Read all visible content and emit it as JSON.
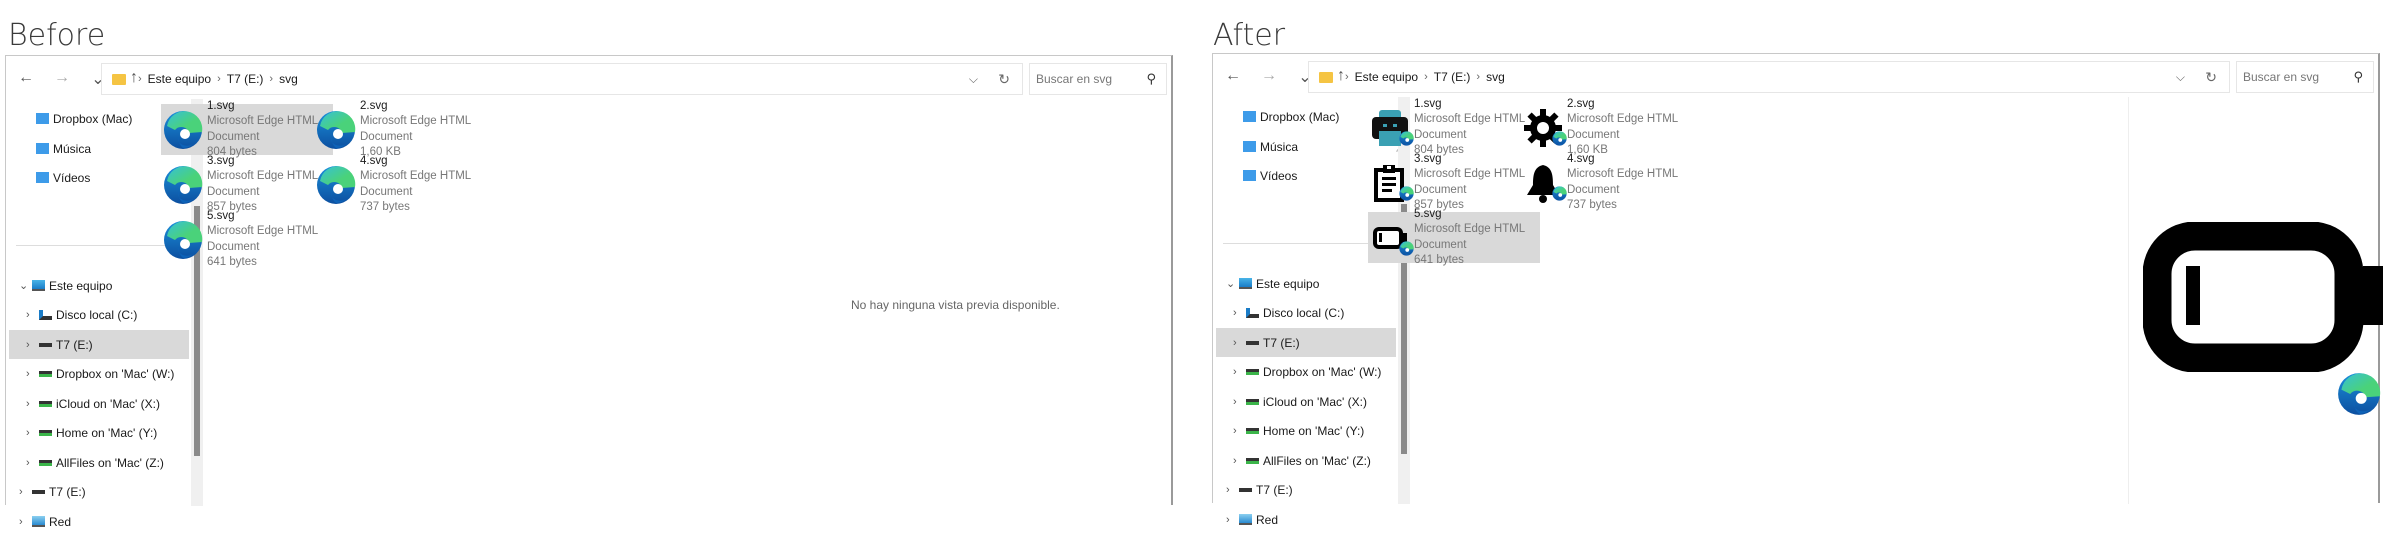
{
  "panels": [
    {
      "label": "Before",
      "selected_file": 0,
      "selected_nav": "T7 (E:)",
      "preview_text": "No hay ninguna vista previa disponible.",
      "icon_style": "edge"
    },
    {
      "label": "After",
      "selected_file": 4,
      "selected_nav": "T7 (E:)",
      "preview_icon": "battery-low-icon",
      "icon_style": "custom"
    }
  ],
  "nav_buttons": [
    "back",
    "forward",
    "recent",
    "up"
  ],
  "breadcrumb": [
    "Este equipo",
    "T7 (E:)",
    "svg"
  ],
  "search_placeholder": "Buscar en svg",
  "nav_quick": [
    {
      "label": "Dropbox (Mac)",
      "color": "#3d9be9"
    },
    {
      "label": "Música",
      "color": "#3d9be9"
    },
    {
      "label": "Vídeos",
      "color": "#3d9be9"
    }
  ],
  "nav_tree": [
    {
      "label": "Este equipo",
      "level": 0,
      "expanded": true,
      "icon": "pc"
    },
    {
      "label": "Disco local (C:)",
      "level": 1,
      "icon": "windrive"
    },
    {
      "label": "T7 (E:)",
      "level": 1,
      "icon": "drive"
    },
    {
      "label": "Dropbox on 'Mac' (W:)",
      "level": 1,
      "icon": "netdrive"
    },
    {
      "label": "iCloud on 'Mac' (X:)",
      "level": 1,
      "icon": "netdrive"
    },
    {
      "label": "Home on 'Mac' (Y:)",
      "level": 1,
      "icon": "netdrive"
    },
    {
      "label": "AllFiles on 'Mac' (Z:)",
      "level": 1,
      "icon": "netdrive"
    },
    {
      "label": "T7 (E:)",
      "level": 0,
      "icon": "drive"
    },
    {
      "label": "Red",
      "level": 0,
      "icon": "network"
    }
  ],
  "files": [
    {
      "name": "1.svg",
      "type": "Microsoft Edge HTML Document",
      "size": "804 bytes",
      "after_icon": "printer"
    },
    {
      "name": "2.svg",
      "type": "Microsoft Edge HTML Document",
      "size": "1,60 KB",
      "after_icon": "gear"
    },
    {
      "name": "3.svg",
      "type": "Microsoft Edge HTML Document",
      "size": "857 bytes",
      "after_icon": "clipboard"
    },
    {
      "name": "4.svg",
      "type": "Microsoft Edge HTML Document",
      "size": "737 bytes",
      "after_icon": "bell"
    },
    {
      "name": "5.svg",
      "type": "Microsoft Edge HTML Document",
      "size": "641 bytes",
      "after_icon": "battery"
    }
  ]
}
